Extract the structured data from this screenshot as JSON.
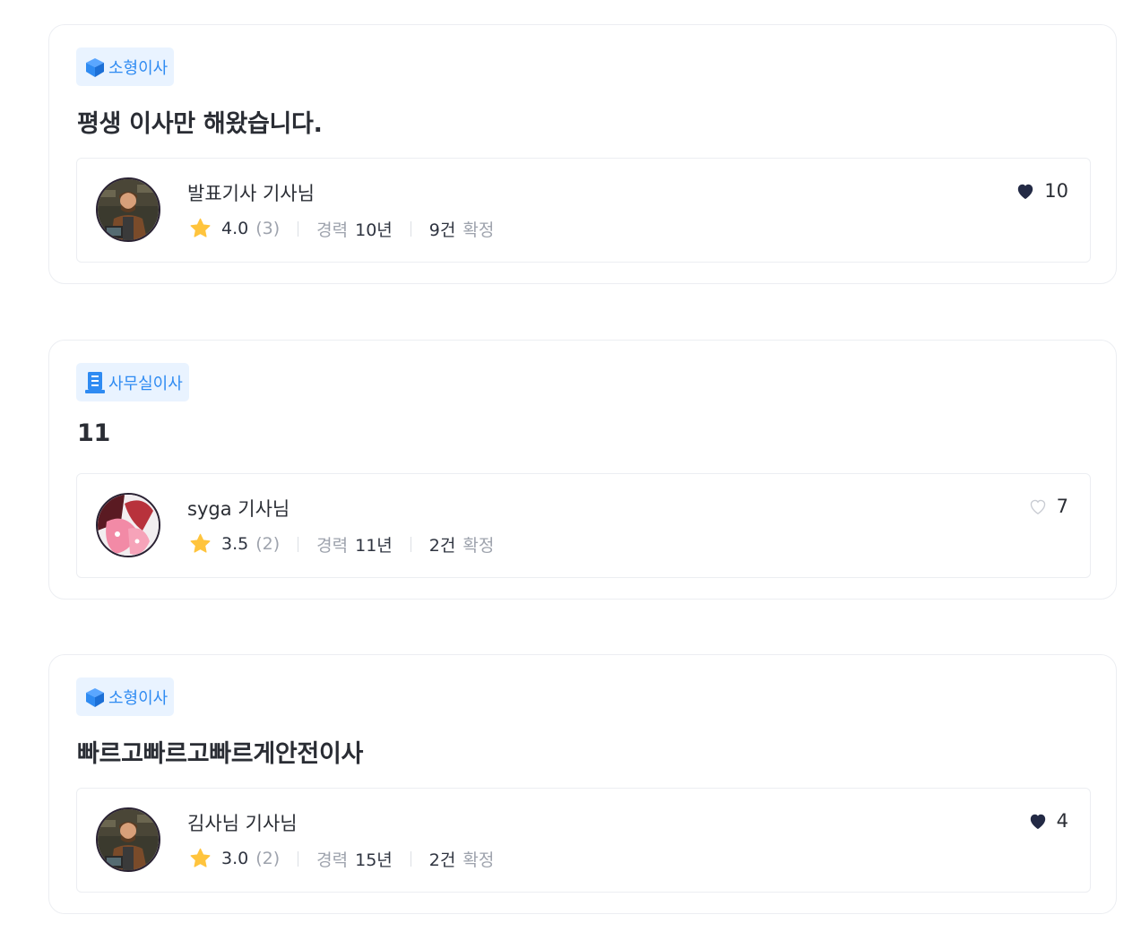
{
  "posts": [
    {
      "category": "소형이사",
      "category_icon": "cube-icon",
      "title": "평생 이사만 해왔습니다.",
      "driver": {
        "name": "발표기사 기사님",
        "rating": "4.0",
        "review_count": "(3)",
        "career_label": "경력",
        "career_value": "10년",
        "confirmed_count": "9건",
        "confirmed_label": "확정",
        "likes": "10",
        "liked": true
      }
    },
    {
      "category": "사무실이사",
      "category_icon": "building-icon",
      "title": "11",
      "driver": {
        "name": "syga 기사님",
        "rating": "3.5",
        "review_count": "(2)",
        "career_label": "경력",
        "career_value": "11년",
        "confirmed_count": "2건",
        "confirmed_label": "확정",
        "likes": "7",
        "liked": false
      }
    },
    {
      "category": "소형이사",
      "category_icon": "cube-icon",
      "title": "빠르고빠르고빠르게안전이사",
      "driver": {
        "name": "김사님 기사님",
        "rating": "3.0",
        "review_count": "(2)",
        "career_label": "경력",
        "career_value": "15년",
        "confirmed_count": "2건",
        "confirmed_label": "확정",
        "likes": "4",
        "liked": true
      }
    }
  ],
  "colors": {
    "accent": "#2f8bf2",
    "tag_bg": "#e9f3ff",
    "star": "#ffc43d",
    "heart": "#232a45",
    "muted": "#9ea3ad"
  }
}
